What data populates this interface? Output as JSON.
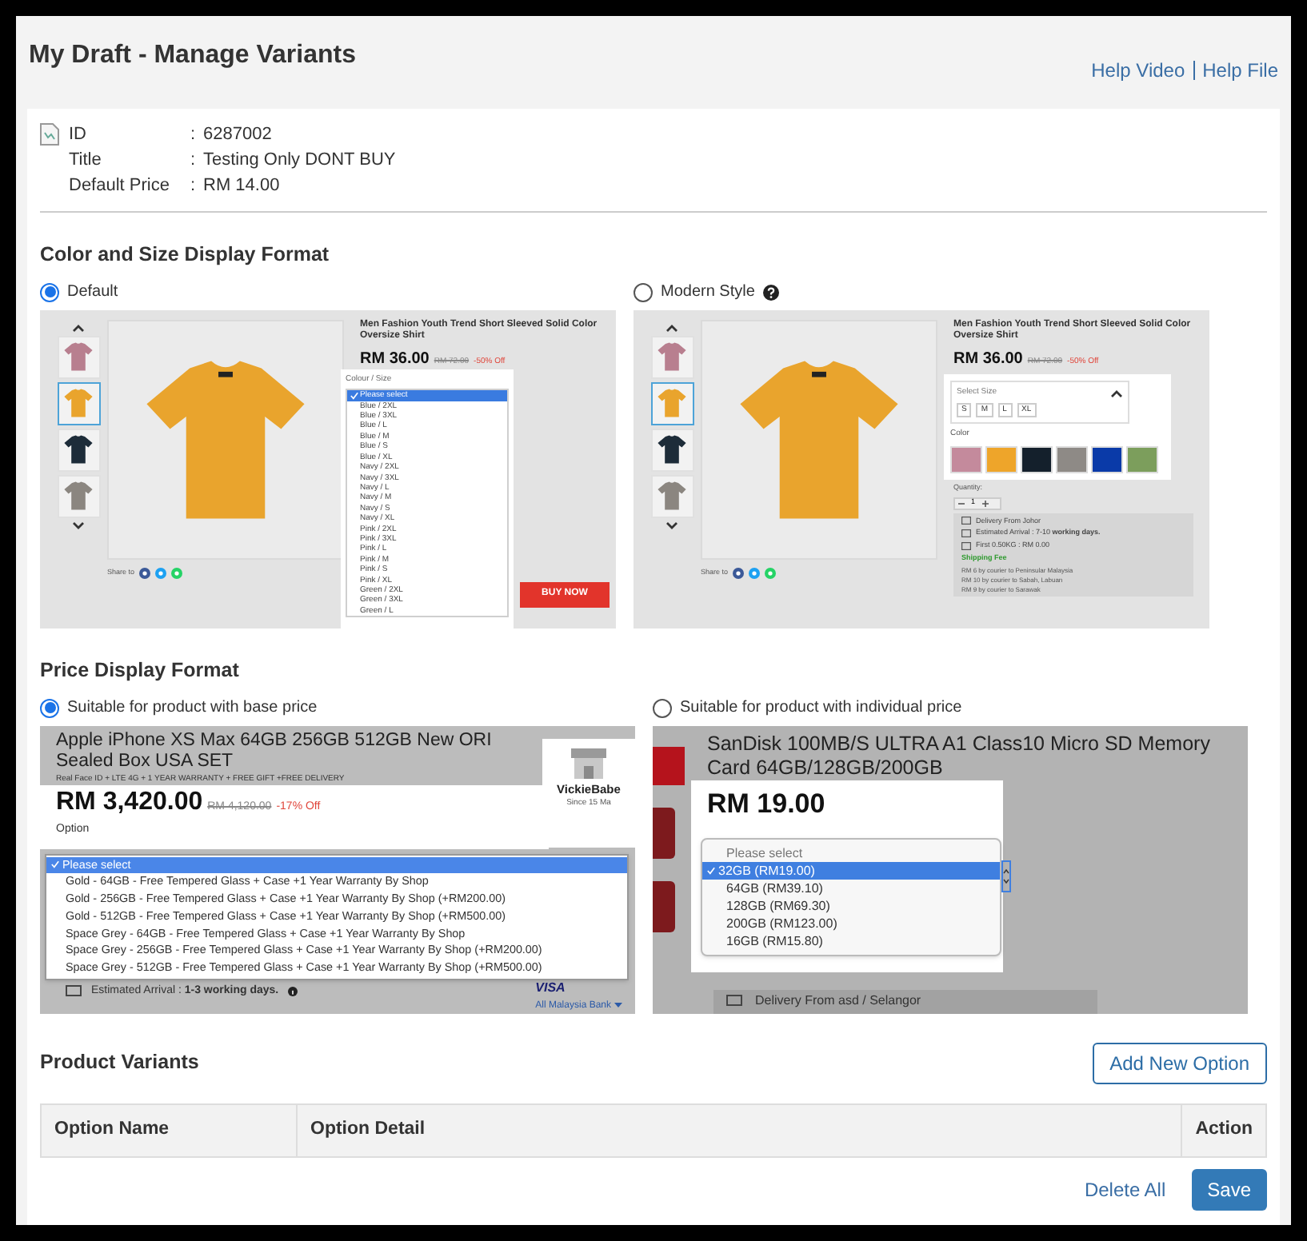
{
  "header": {
    "title": "My Draft - Manage Variants",
    "links": [
      "Help Video",
      "Help File"
    ]
  },
  "product": {
    "fields": [
      {
        "label": "ID",
        "separator": ":",
        "value": "6287002"
      },
      {
        "label": "Title",
        "separator": ":",
        "value": "Testing Only DONT BUY"
      },
      {
        "label": "Default Price",
        "separator": ":",
        "value": "RM 14.00"
      }
    ]
  },
  "color_size_format": {
    "heading": "Color and Size Display Format",
    "options": [
      {
        "kind": "dropdown",
        "label": "Default",
        "selected": true,
        "help": false,
        "preview": {
          "thumbnails": [
            {
              "color": "#b87f8f",
              "selected": false
            },
            {
              "color": "#e9a42d",
              "selected": true
            },
            {
              "color": "#1d2c39",
              "selected": false
            },
            {
              "color": "#8b8680",
              "selected": false
            }
          ],
          "title": "Men Fashion Youth Trend Short Sleeved Solid Color Oversize Shirt",
          "price": "RM 36.00",
          "old_price": "RM 72.00",
          "discount": "-50% Off",
          "select_label": "Colour / Size",
          "choices": [
            {
              "label": "Please select",
              "selected": true
            },
            {
              "label": "Blue / 2XL",
              "selected": false
            },
            {
              "label": "Blue / 3XL",
              "selected": false
            },
            {
              "label": "Blue / L",
              "selected": false
            },
            {
              "label": "Blue / M",
              "selected": false
            },
            {
              "label": "Blue / S",
              "selected": false
            },
            {
              "label": "Blue / XL",
              "selected": false
            },
            {
              "label": "Navy / 2XL",
              "selected": false
            },
            {
              "label": "Navy / 3XL",
              "selected": false
            },
            {
              "label": "Navy / L",
              "selected": false
            },
            {
              "label": "Navy / M",
              "selected": false
            },
            {
              "label": "Navy / S",
              "selected": false
            },
            {
              "label": "Navy / XL",
              "selected": false
            },
            {
              "label": "Pink / 2XL",
              "selected": false
            },
            {
              "label": "Pink / 3XL",
              "selected": false
            },
            {
              "label": "Pink / L",
              "selected": false
            },
            {
              "label": "Pink / M",
              "selected": false
            },
            {
              "label": "Pink / S",
              "selected": false
            },
            {
              "label": "Pink / XL",
              "selected": false
            },
            {
              "label": "Green / 2XL",
              "selected": false
            },
            {
              "label": "Green / 3XL",
              "selected": false
            },
            {
              "label": "Green / L",
              "selected": false
            }
          ],
          "share_label": "Share to",
          "buy_button": "BUY NOW"
        }
      },
      {
        "kind": "swatches",
        "label": "Modern Style",
        "selected": false,
        "help": true,
        "preview": {
          "thumbnails": [
            {
              "color": "#b87f8f",
              "selected": false
            },
            {
              "color": "#e9a42d",
              "selected": true
            },
            {
              "color": "#1d2c39",
              "selected": false
            },
            {
              "color": "#8b8680",
              "selected": false
            }
          ],
          "title": "Men Fashion Youth Trend Short Sleeved Solid Color Oversize Shirt",
          "price": "RM 36.00",
          "old_price": "RM 72.00",
          "discount": "-50% Off",
          "size_label": "Select Size",
          "sizes": [
            "S",
            "M",
            "L",
            "XL"
          ],
          "color_label": "Color",
          "swatches": [
            {
              "color": "#c48a9c"
            },
            {
              "color": "#eea52a"
            },
            {
              "color": "#14202c"
            },
            {
              "color": "#8e8a86"
            },
            {
              "color": "#0a3aa8"
            },
            {
              "color": "#7c9e5c"
            }
          ],
          "quantity_label": "Quantity:",
          "quantity": "1",
          "delivery": [
            "Delivery From Johor",
            "Estimated Arrival : 7-10 **working days.**",
            "First 0.50KG : RM 0.00"
          ],
          "shipping_label": "Shipping Fee",
          "shipping_lines": [
            "RM 6 by courier to Peninsular Malaysia",
            "RM 10 by courier to Sabah, Labuan",
            "RM 9 by courier to Sarawak"
          ],
          "share_label": "Share to"
        }
      }
    ]
  },
  "price_format": {
    "heading": "Price Display Format",
    "options": [
      {
        "kind": "base_price",
        "label": "Suitable for product with base price",
        "selected": true,
        "preview": {
          "title": "Apple iPhone XS Max 64GB 256GB 512GB New ORI Sealed Box USA SET",
          "subtitle": "Real Face ID + LTE 4G + 1 YEAR WARRANTY + FREE GIFT +FREE DELIVERY",
          "price": "RM 3,420.00",
          "old_price": "RM 4,120.00",
          "discount": "-17% Off",
          "option_label": "Option",
          "choices": [
            {
              "label": "Please select",
              "selected": true
            },
            {
              "label": "Gold - 64GB - Free Tempered Glass + Case +1 Year Warranty By Shop",
              "selected": false
            },
            {
              "label": "Gold - 256GB - Free Tempered Glass + Case +1 Year Warranty By Shop (+RM200.00)",
              "selected": false
            },
            {
              "label": "Gold - 512GB - Free Tempered Glass + Case +1 Year Warranty By Shop (+RM500.00)",
              "selected": false
            },
            {
              "label": "Space Grey - 64GB - Free Tempered Glass + Case +1 Year Warranty By Shop",
              "selected": false
            },
            {
              "label": "Space Grey - 256GB - Free Tempered Glass + Case +1 Year Warranty By Shop (+RM200.00)",
              "selected": false
            },
            {
              "label": "Space Grey - 512GB - Free Tempered Glass + Case +1 Year Warranty By Shop (+RM500.00)",
              "selected": false
            }
          ],
          "seller": "VickieBabe",
          "seller_since": "Since 15 Ma",
          "arrival": "Estimated Arrival : **1-3 working days.**",
          "card_brand": "VISA",
          "bank": "All Malaysia Bank"
        }
      },
      {
        "kind": "individual_price",
        "label": "Suitable for product with individual price",
        "selected": false,
        "preview": {
          "title": "SanDisk 100MB/S ULTRA A1 Class10 Micro SD Memory Card 64GB/128GB/200GB",
          "price": "RM 19.00",
          "choices": [
            {
              "label": "Please select",
              "selected": false,
              "disabled": true
            },
            {
              "label": "32GB (RM19.00)",
              "selected": true,
              "disabled": false
            },
            {
              "label": "64GB (RM39.10)",
              "selected": false,
              "disabled": false
            },
            {
              "label": "128GB (RM69.30)",
              "selected": false,
              "disabled": false
            },
            {
              "label": "200GB (RM123.00)",
              "selected": false,
              "disabled": false
            },
            {
              "label": "16GB (RM15.80)",
              "selected": false,
              "disabled": false
            }
          ],
          "delivery": "Delivery From asd / Selangor"
        }
      }
    ]
  },
  "variants": {
    "heading": "Product Variants",
    "add_button": "Add New Option",
    "columns": [
      "Option Name",
      "Option Detail",
      "Action"
    ],
    "delete_all": "Delete All",
    "save": "Save"
  }
}
